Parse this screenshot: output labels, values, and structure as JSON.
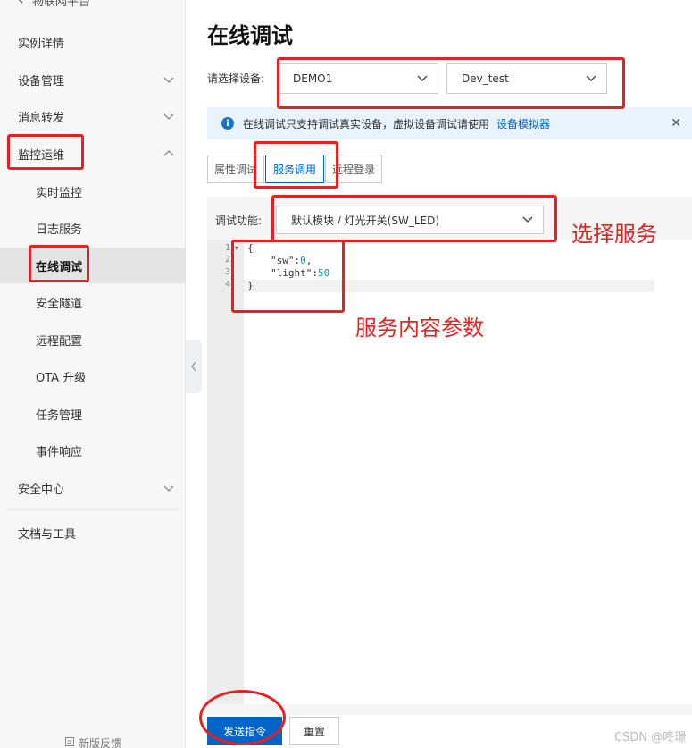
{
  "sidebar": {
    "back_label": "物联网平台",
    "items": [
      {
        "label": "实例详情"
      },
      {
        "label": "设备管理"
      },
      {
        "label": "消息转发"
      },
      {
        "label": "监控运维"
      },
      {
        "label": "实时监控"
      },
      {
        "label": "日志服务"
      },
      {
        "label": "在线调试"
      },
      {
        "label": "安全隧道"
      },
      {
        "label": "远程配置"
      },
      {
        "label": "OTA 升级"
      },
      {
        "label": "任务管理"
      },
      {
        "label": "事件响应"
      },
      {
        "label": "安全中心"
      },
      {
        "label": "文档与工具"
      }
    ],
    "feedback_label": "新版反馈"
  },
  "main": {
    "title": "在线调试",
    "device_label": "请选择设备:",
    "product_select": "DEMO1",
    "device_select": "Dev_test",
    "notice_text": "在线调试只支持调试真实设备，虚拟设备调试请使用",
    "notice_link": "设备模拟器",
    "tabs": [
      {
        "label": "属性调试"
      },
      {
        "label": "服务调用"
      },
      {
        "label": "远程登录"
      }
    ],
    "func_label": "调试功能:",
    "func_select": "默认模块 / 灯光开关(SW_LED)",
    "code": {
      "line1": "{",
      "line2_key": "\"sw\":",
      "line2_val": "0",
      "line2_tail": ",",
      "line3_key": "\"light\":",
      "line3_val": "50",
      "line4": "}",
      "line_numbers": [
        "1",
        "2",
        "3",
        "4"
      ]
    },
    "send_button": "发送指令",
    "reset_button": "重置"
  },
  "annotations": {
    "select_service": "选择服务",
    "service_params": "服务内容参数"
  },
  "watermark": "CSDN @咚璟",
  "colors": {
    "accent": "#0064c8",
    "annotation": "#e52222",
    "notice_bg": "#e8f3fd"
  }
}
